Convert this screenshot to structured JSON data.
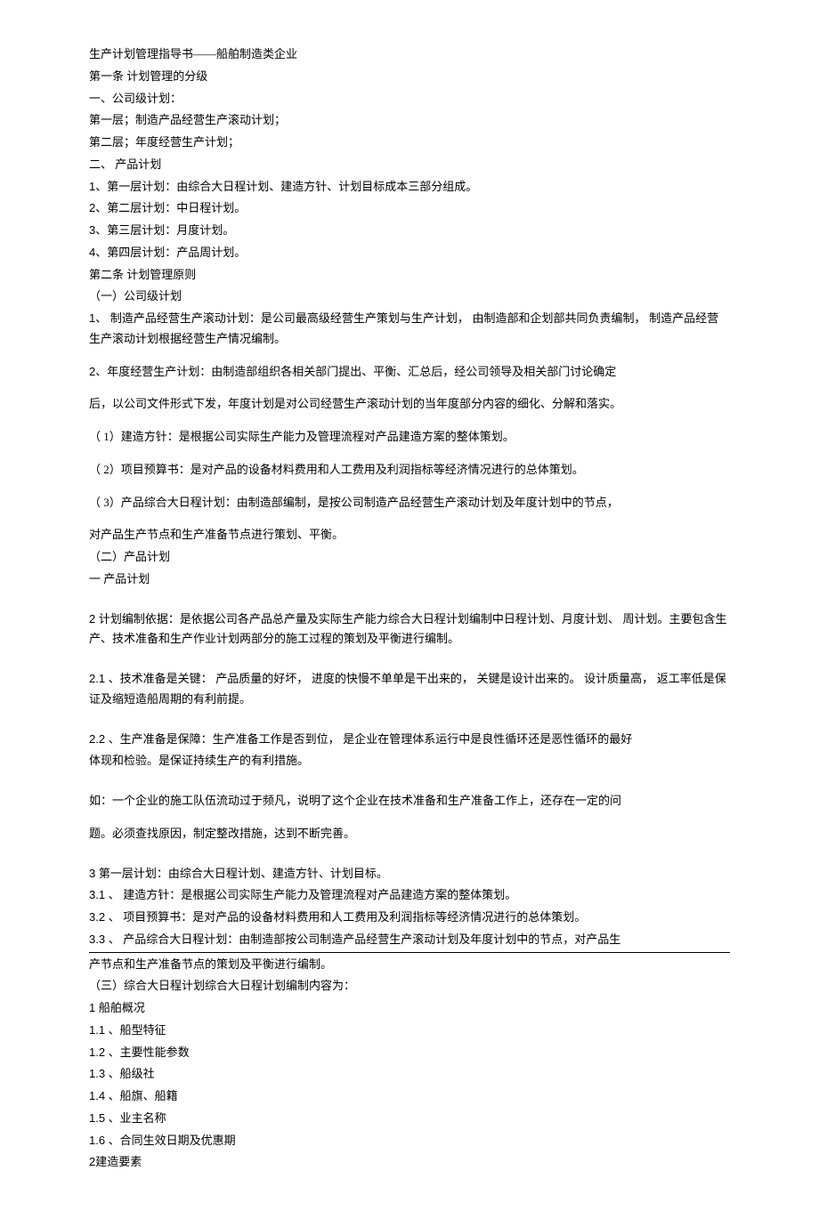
{
  "doc": {
    "title": "生产计划管理指导书——船舶制造类企业",
    "art1_heading": "第一条 计划管理的分级",
    "sec1_1": "一、公司级计划：",
    "sec1_1_l1": "第一层；制造产品经营生产滚动计划；",
    "sec1_1_l2": "第二层；年度经营生产计划；",
    "sec1_2": "二、  产品计划",
    "sec1_2_i1": "1、第一层计划：由综合大日程计划、建造方针、计划目标成本三部分组成。",
    "sec1_2_i2": "2、第二层计划：中日程计划。",
    "sec1_2_i3": "3、第三层计划：月度计划。",
    "sec1_2_i4": "4、第四层计划：产品周计划。",
    "art2_heading": "第二条 计划管理原则",
    "art2_s1": "（一）公司级计划",
    "art2_p1": "1、  制造产品经营生产滚动计划：是公司最高级经营生产策划与生产计划，  由制造部和企划部共同负责编制，  制造产品经营生产滚动计划根据经营生产情况编制。",
    "art2_p2_a": "2、年度经营生产计划：由制造部组织各相关部门提出、平衡、汇总后，经公司领导及相关部门讨论确定",
    "art2_p2_b": "后，以公司文件形式下发，年度计划是对公司经营生产滚动计划的当年度部分内容的细化、分解和落实。",
    "art2_p3": "（ 1）建造方针：是根据公司实际生产能力及管理流程对产品建造方案的整体策划。",
    "art2_p4": "（ 2）项目预算书：是对产品的设备材料费用和人工费用及利润指标等经济情况进行的总体策划。",
    "art2_p5": "（ 3）产品综合大日程计划：由制造部编制，是按公司制造产品经营生产滚动计划及年度计划中的节点，",
    "art2_p5b": "对产品生产节点和生产准备节点进行策划、平衡。",
    "art2_s2": "（二）产品计划",
    "art2_s2_h": "一 产品计划",
    "art2_s2_p1": "2 计划编制依据：是依据公司各产品总产量及实际生产能力综合大日程计划编制中日程计划、月度计划、  周计划。主要包含生产、技术准备和生产作业计划两部分的施工过程的策划及平衡进行编制。",
    "art2_s2_p2": "2.1 、技术准备是关键：  产品质量的好坏，  进度的快慢不单单是干出来的，  关键是设计出来的。  设计质量高，  返工率低是保证及缩短造船周期的有利前提。",
    "art2_s2_p3a": "2.2 、生产准备是保障：生产准备工作是否到位，  是企业在管理体系运行中是良性循环还是恶性循环的最好",
    "art2_s2_p3b": "体现和检验。是保证持续生产的有利措施。",
    "art2_s2_p4a": "如：一个企业的施工队伍流动过于频凡，说明了这个企业在技术准备和生产准备工作上，还存在一定的问",
    "art2_s2_p4b": "题。必须查找原因，制定整改措施，达到不断完善。",
    "art2_s3_h": "3 第一层计划：由综合大日程计划、建造方针、计划目标。",
    "art2_s3_i1": "3.1 、    建造方针：是根据公司实际生产能力及管理流程对产品建造方案的整体策划。",
    "art2_s3_i2": "3.2 、    项目预算书：是对产品的设备材料费用和人工费用及利润指标等经济情况进行的总体策划。",
    "art2_s3_i3": "3.3 、    产品综合大日程计划：由制造部按公司制造产品经营生产滚动计划及年度计划中的节点，对产品生",
    "art2_s3_i3b": "产节点和生产准备节点的策划及平衡进行编制。",
    "art2_s4": "（三）综合大日程计划综合大日程计划编制内容为：",
    "list1_h": "1    船舶概况",
    "list1_1": "1.1 、船型特征",
    "list1_2": "1.2 、主要性能参数",
    "list1_3": "1.3 、船级社",
    "list1_4": "1.4 、船旗、船籍",
    "list1_5": "1.5 、业主名称",
    "list1_6": "1.6 、合同生效日期及优惠期",
    "list2_h": "2建造要素"
  }
}
